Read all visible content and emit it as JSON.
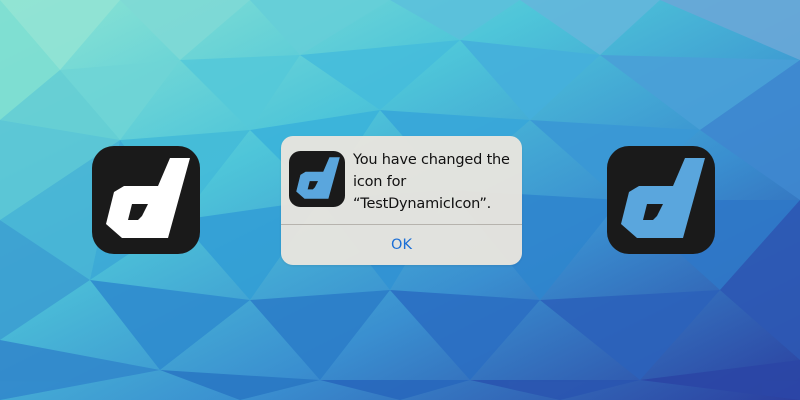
{
  "wallpaper": {
    "colors": [
      "#86e0d2",
      "#4fc3d8",
      "#3d95d2",
      "#2f64b8",
      "#2a3fa0"
    ]
  },
  "icons": {
    "left": {
      "name": "d-logo-icon",
      "glyph_color": "#ffffff",
      "background": "#1a1a1a"
    },
    "right": {
      "name": "d-logo-icon",
      "glyph_color": "#5aa6dd",
      "background": "#1a1a1a"
    }
  },
  "alert": {
    "message_line1": "You have changed the",
    "message_line2": "icon for",
    "message_line3": "“TestDynamicIcon”.",
    "ok_label": "OK",
    "icon_name": "d-logo-icon",
    "icon_glyph_color": "#5aa6dd",
    "button_color": "#1b6fd6"
  }
}
